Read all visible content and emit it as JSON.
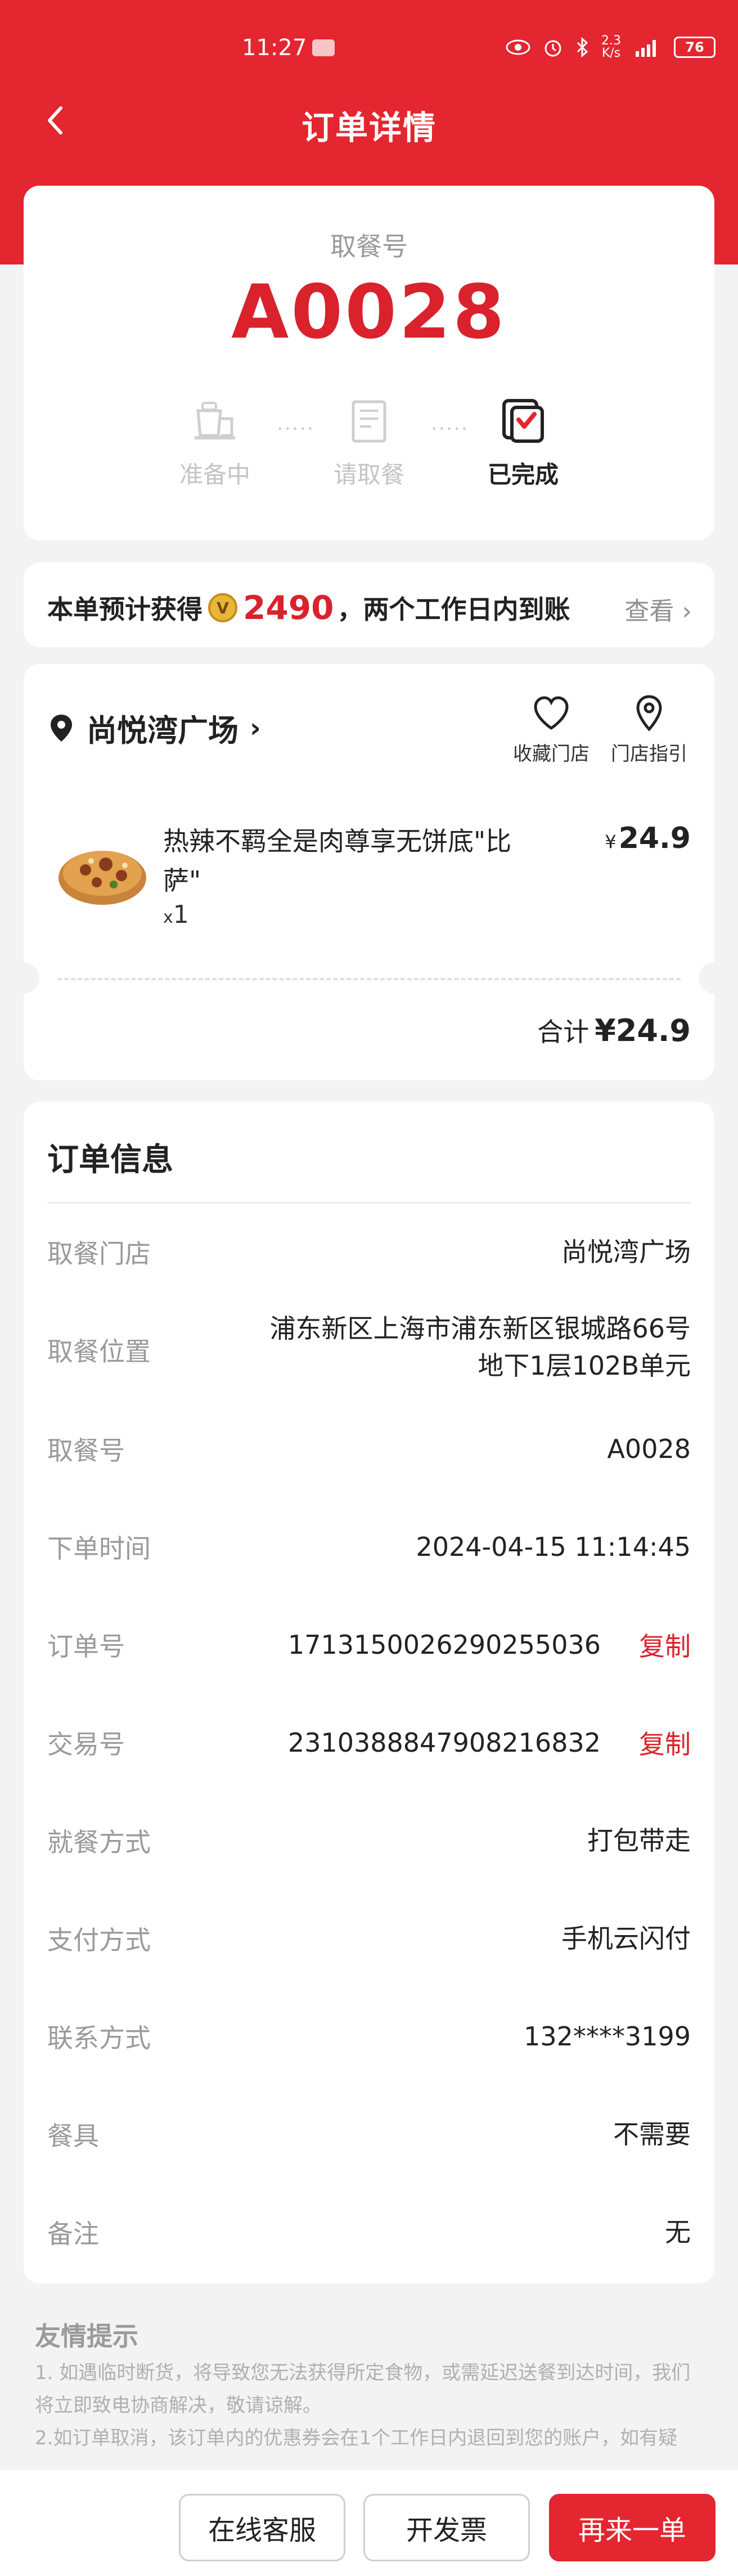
{
  "status_bar": {
    "time": "11:27",
    "speed": "2.3\nK/s",
    "battery": "76"
  },
  "nav": {
    "title": "订单详情"
  },
  "pickup": {
    "label": "取餐号",
    "number": "A0028",
    "steps": [
      {
        "label": "准备中",
        "icon": "tray-icon",
        "state": "inactive"
      },
      {
        "label": "请取餐",
        "icon": "bag-icon",
        "state": "inactive"
      },
      {
        "label": "已完成",
        "icon": "completed-bag-icon",
        "state": "done"
      }
    ],
    "dots": "·····"
  },
  "points": {
    "prefix": "本单预计获得",
    "coin": "V",
    "amount": "2490",
    "suffix": "，两个工作日内到账",
    "view": "查看 ›"
  },
  "store": {
    "name": "尚悦湾广场",
    "chevron": "›",
    "actions": [
      {
        "label": "收藏门店",
        "icon": "heart-icon"
      },
      {
        "label": "门店指引",
        "icon": "location-pin-icon"
      }
    ],
    "item": {
      "name": "热辣不羁全是肉尊享无饼底\"比萨\"",
      "qty_prefix": "x",
      "qty": "1",
      "price_symbol": "¥",
      "price": "24.9"
    },
    "total_label": "合计",
    "total": "¥24.9"
  },
  "order_info": {
    "title": "订单信息",
    "copy_label": "复制",
    "rows": [
      {
        "key": "取餐门店",
        "value": "尚悦湾广场"
      },
      {
        "key": "取餐位置",
        "value": "浦东新区上海市浦东新区银城路66号\n地下1层102B单元"
      },
      {
        "key": "取餐号",
        "value": "A0028"
      },
      {
        "key": "下单时间",
        "value": "2024-04-15 11:14:45"
      },
      {
        "key": "订单号",
        "value": "1713150026290255036"
      },
      {
        "key": "交易号",
        "value": "2310388847908216832"
      },
      {
        "key": "就餐方式",
        "value": "打包带走"
      },
      {
        "key": "支付方式",
        "value": "手机云闪付"
      },
      {
        "key": "联系方式",
        "value": "132****3199"
      },
      {
        "key": "餐具",
        "value": "不需要"
      },
      {
        "key": "备注",
        "value": "无"
      }
    ]
  },
  "tips": {
    "title": "友情提示",
    "text": "1. 如遇临时断货，将导致您无法获得所定食物，或需延迟送餐到达时间，我们将立即致电协商解决，敬请谅解。\n2.如订单取消，该订单内的优惠券会在1个工作日内退回到您的账户，如有疑"
  },
  "bottom": {
    "service": "在线客服",
    "invoice": "开发票",
    "reorder": "再来一单"
  },
  "colors": {
    "brand_red": "#e3262f",
    "accent_red": "#d9222c",
    "coin_gold": "#e8b53d"
  }
}
